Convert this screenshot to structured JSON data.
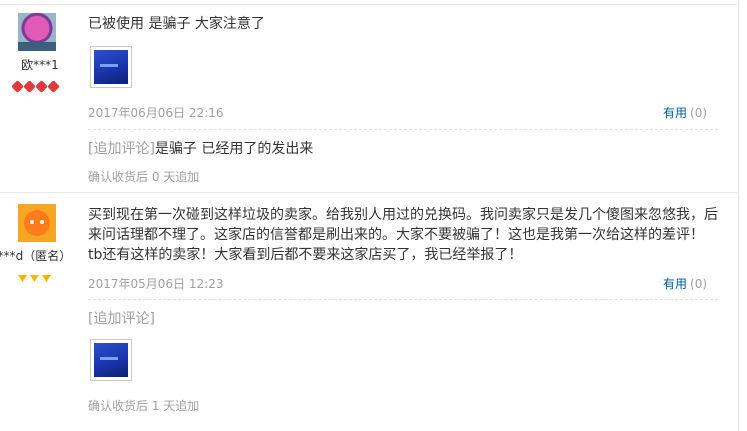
{
  "reviews": [
    {
      "username": "欧***1",
      "avatar_icon": "user-avatar-icon",
      "badge_icon": "heart-badge-icon",
      "badge_count": 4,
      "text": "已被使用 是骗子 大家注意了",
      "date": "2017年06月06日 22:16",
      "useful_label": "有用",
      "useful_count": "(0)",
      "append_tag": "[追加评论]",
      "append_text": "是骗子 已经用了的发出来",
      "append_note": "确认收货后 0 天追加"
    },
    {
      "username": "d***d（匿名）",
      "avatar_icon": "anonymous-avatar-icon",
      "badge_icon": "diamond-badge-icon",
      "badge_count": 3,
      "text": "买到现在第一次碰到这样垃圾的卖家。给我别人用过的兑换码。我问卖家只是发几个傻图来忽悠我，后来问话理都不理了。这家店的信誉都是刷出来的。大家不要被骗了！这也是我第一次给这样的差评！tb还有这样的卖家！大家看到后都不要来这家店买了，我已经举报了！",
      "date": "2017年05月06日 12:23",
      "useful_label": "有用",
      "useful_count": "(0)",
      "append_tag": "[追加评论]",
      "append_text": "",
      "append_note": "确认收货后 1 天追加"
    }
  ],
  "colors": {
    "link": "#005aa0",
    "muted": "#a0a0a0",
    "heart": "#e4393c",
    "diamond": "#f5b800"
  }
}
